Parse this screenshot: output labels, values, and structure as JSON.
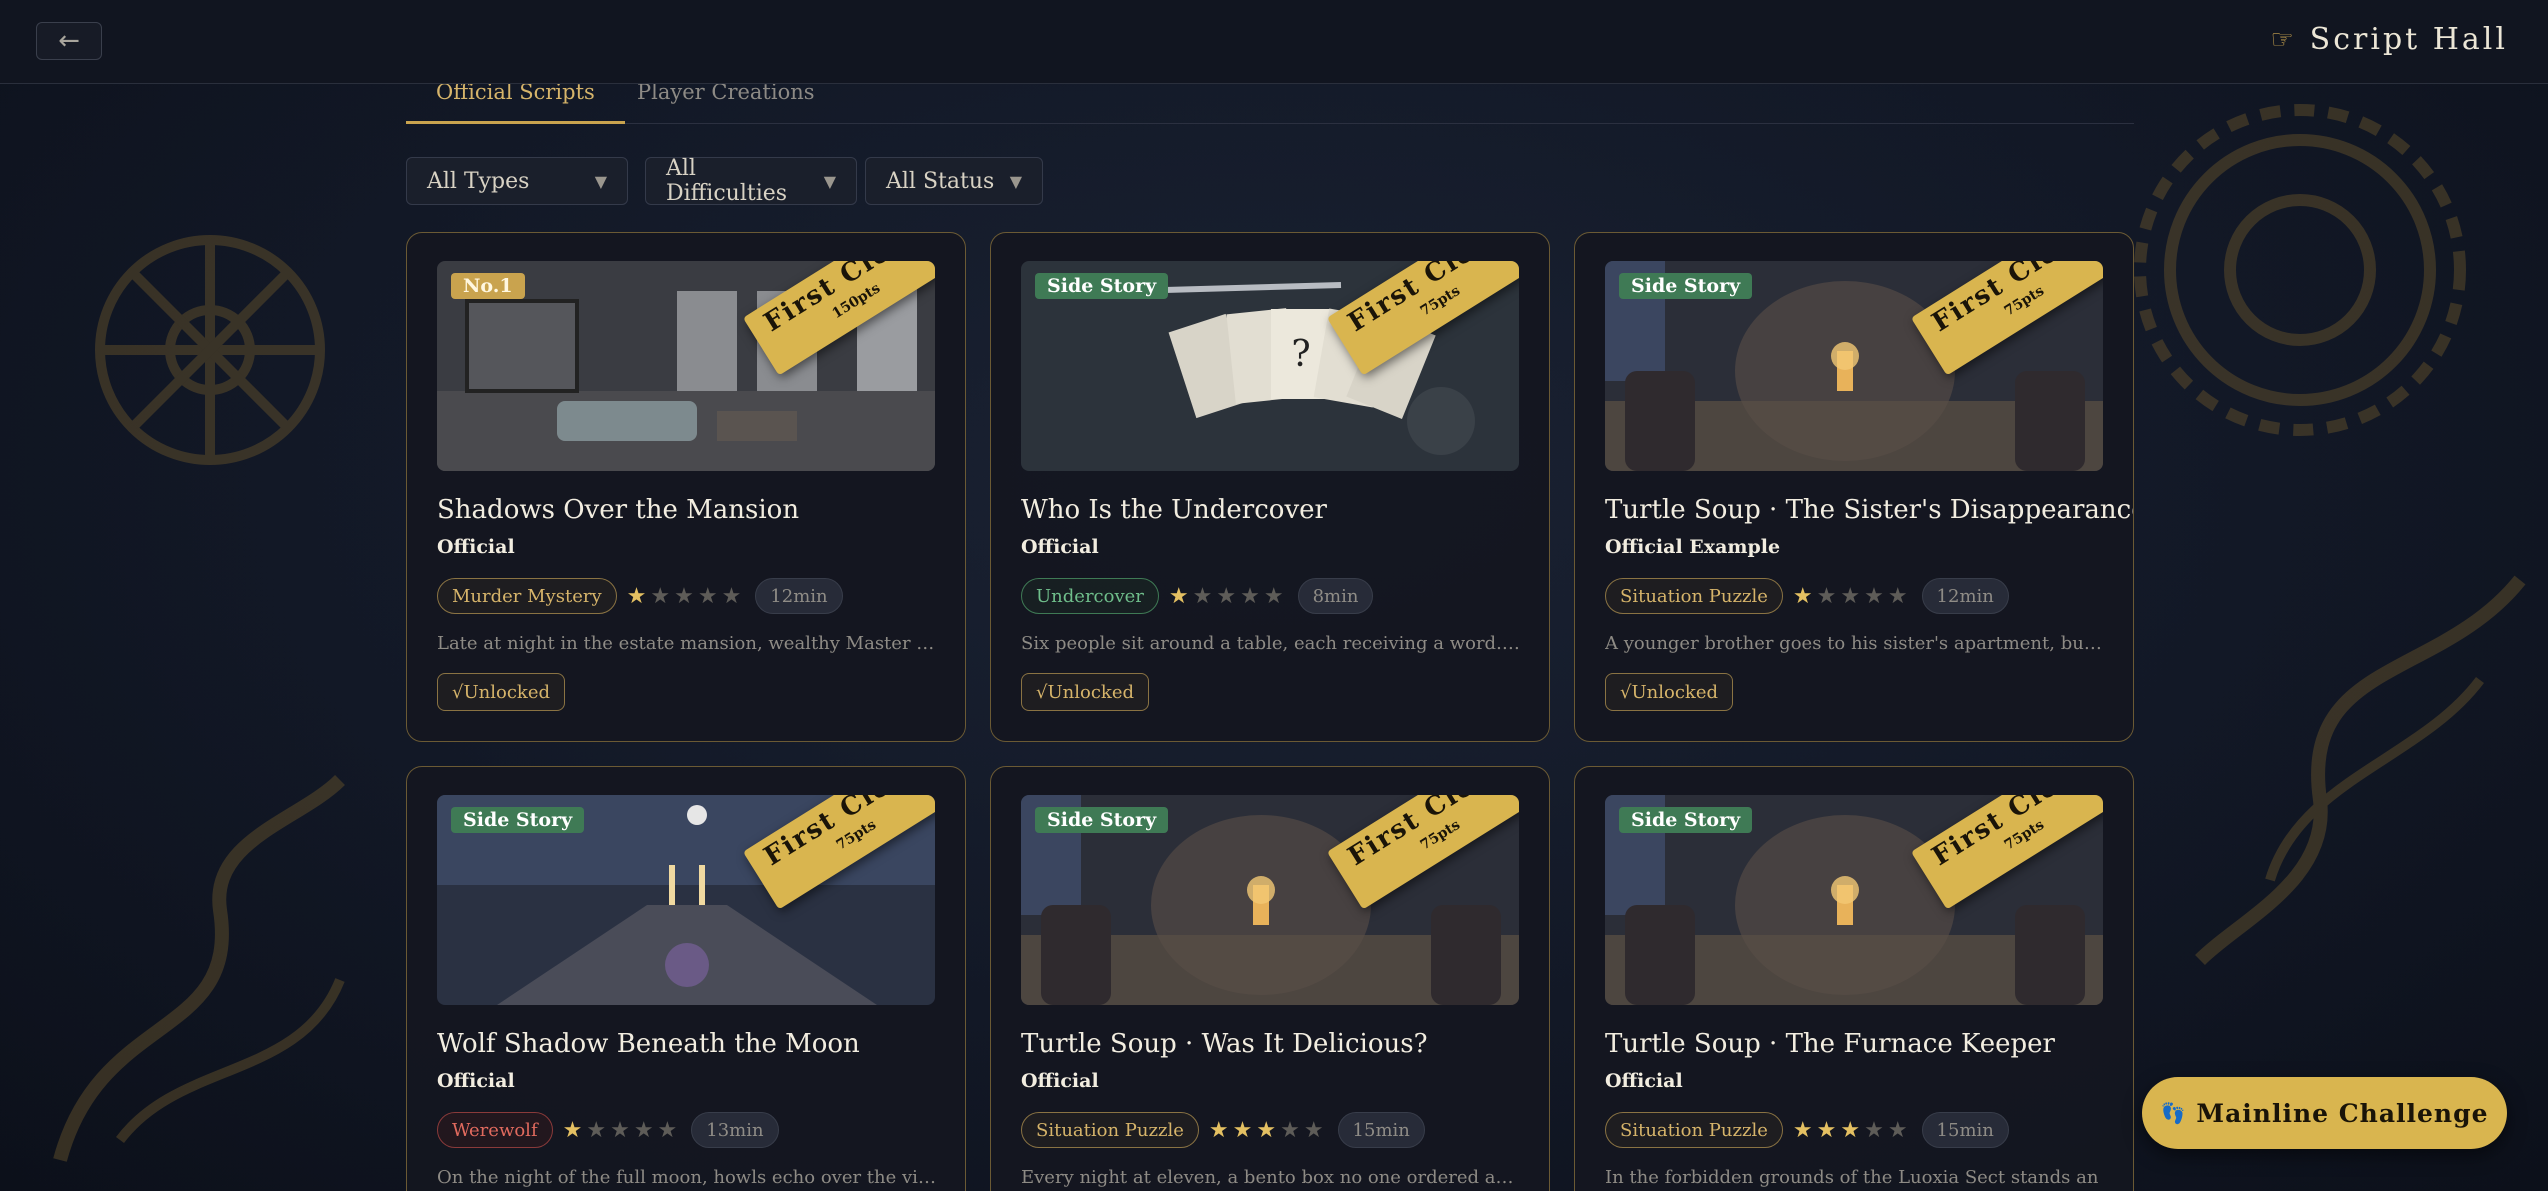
{
  "header": {
    "back_label": "←",
    "brand_icon": "pointing-hand-icon",
    "brand_glyph": "☞",
    "title": "Script Hall"
  },
  "tabs": [
    {
      "label": "Official Scripts",
      "active": true
    },
    {
      "label": "Player Creations",
      "active": false
    }
  ],
  "filters": [
    {
      "label": "All Types"
    },
    {
      "label": "All Difficulties"
    },
    {
      "label": "All Status"
    }
  ],
  "cards": [
    {
      "badge": "No.1",
      "badge_kind": "rank",
      "ribbon": "First Clear",
      "ribbon_pts": "150pts",
      "title": "Shadows Over the Mansion",
      "author": "Official",
      "genre": "Murder Mystery",
      "genre_color": "gold",
      "difficulty": 1,
      "duration": "12min",
      "desc": "Late at night in the estate mansion, wealthy Master Chen is ...",
      "status": "√Unlocked",
      "scene": "mansion"
    },
    {
      "badge": "Side Story",
      "badge_kind": "side",
      "ribbon": "First Clear",
      "ribbon_pts": "75pts",
      "title": "Who Is the Undercover",
      "author": "Official",
      "genre": "Undercover",
      "genre_color": "green",
      "difficulty": 1,
      "duration": "8min",
      "desc": "Six people sit around a table, each receiving a word. One pe...",
      "status": "√Unlocked",
      "scene": "cards"
    },
    {
      "badge": "Side Story",
      "badge_kind": "side",
      "ribbon": "First Clear",
      "ribbon_pts": "75pts",
      "title": "Turtle Soup · The Sister's Disappearance",
      "author": "Official Example",
      "genre": "Situation Puzzle",
      "genre_color": "gold",
      "difficulty": 1,
      "duration": "12min",
      "desc": "A younger brother goes to his sister's apartment, but she is...",
      "status": "√Unlocked",
      "scene": "lamp"
    },
    {
      "badge": "Side Story",
      "badge_kind": "side",
      "ribbon": "First Clear",
      "ribbon_pts": "75pts",
      "title": "Wolf Shadow Beneath the Moon",
      "author": "Official",
      "genre": "Werewolf",
      "genre_color": "red",
      "difficulty": 1,
      "duration": "13min",
      "desc": "On the night of the full moon, howls echo over the village. ...",
      "status": "",
      "scene": "dining"
    },
    {
      "badge": "Side Story",
      "badge_kind": "side",
      "ribbon": "First Clear",
      "ribbon_pts": "75pts",
      "title": "Turtle Soup · Was It Delicious?",
      "author": "Official",
      "genre": "Situation Puzzle",
      "genre_color": "gold",
      "difficulty": 3,
      "duration": "15min",
      "desc": "Every night at eleven, a bento box no one ordered appears at...",
      "status": "",
      "scene": "lamp"
    },
    {
      "badge": "Side Story",
      "badge_kind": "side",
      "ribbon": "First Clear",
      "ribbon_pts": "75pts",
      "title": "Turtle Soup · The Furnace Keeper",
      "author": "Official",
      "genre": "Situation Puzzle",
      "genre_color": "gold",
      "difficulty": 3,
      "duration": "15min",
      "desc": "In the forbidden grounds of the Luoxia Sect stands an",
      "status": "",
      "scene": "lamp"
    }
  ],
  "mainline": {
    "icon": "footprints-icon",
    "glyph": "👣",
    "label": "Mainline Challenge"
  }
}
